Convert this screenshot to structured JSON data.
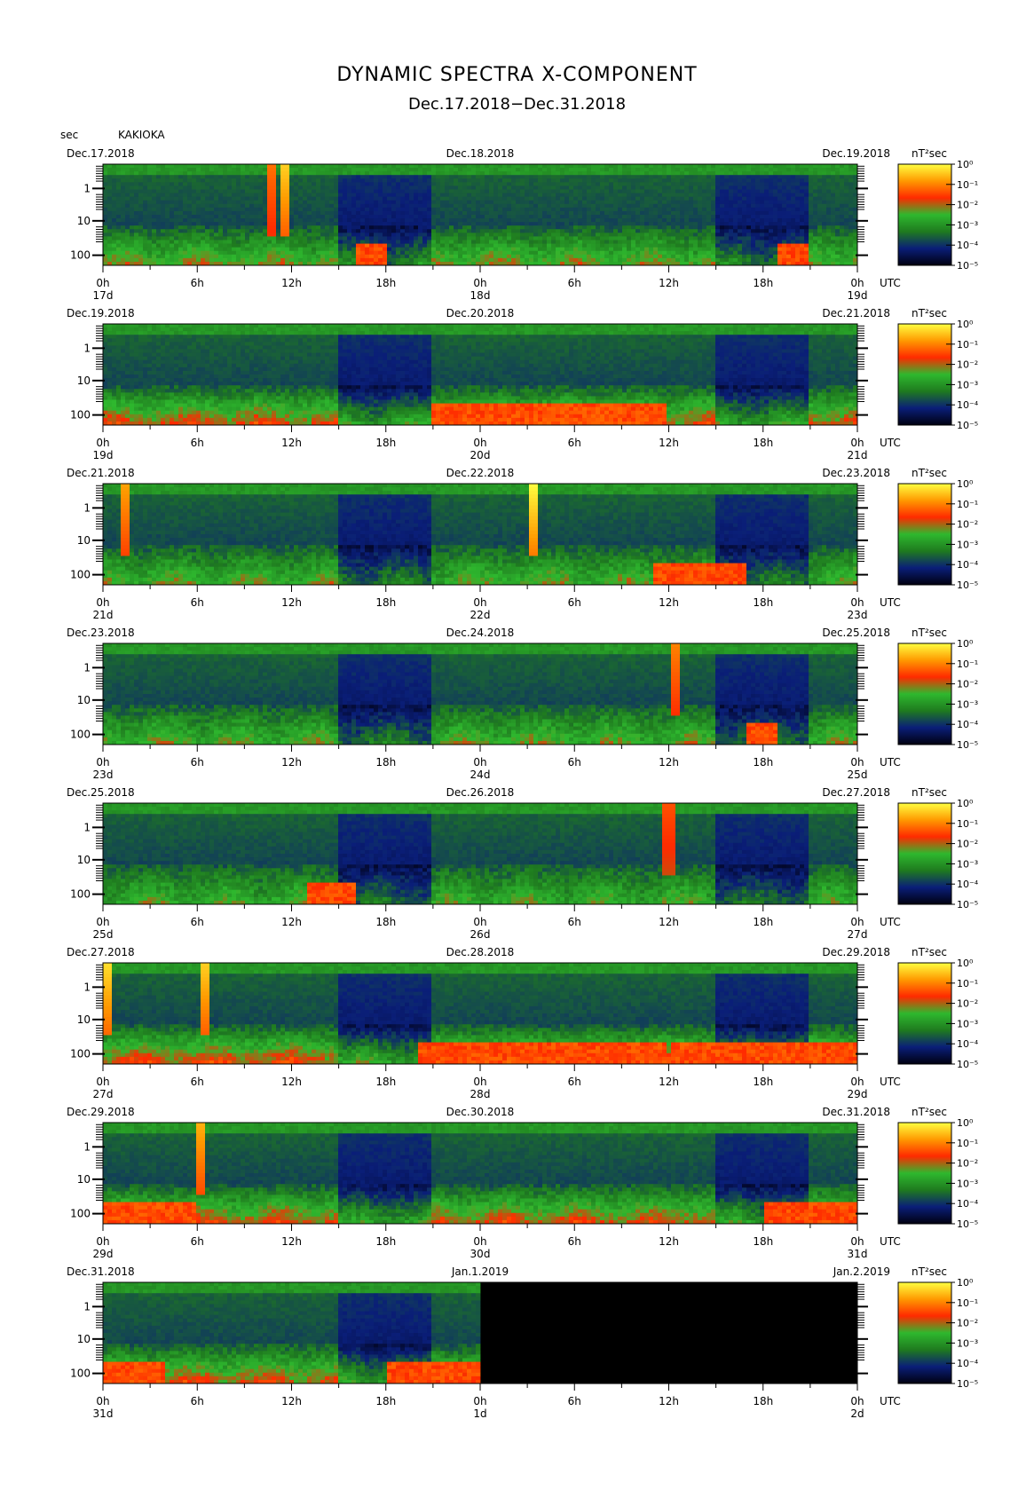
{
  "header": {
    "title": "DYNAMIC SPECTRA X-COMPONENT",
    "subtitle": "Dec.17.2018−Dec.31.2018",
    "y_unit": "sec",
    "station": "KAKIOKA"
  },
  "chart_data": {
    "type": "heatmap",
    "y_scale": "log",
    "y_axis_ticks": [
      "1",
      "10",
      "100"
    ],
    "x_hour_ticks": [
      "0h",
      "6h",
      "12h",
      "18h",
      "0h",
      "6h",
      "12h",
      "18h",
      "0h"
    ],
    "utc_label": "UTC",
    "colorbar_unit": "nT²sec",
    "colorbar_ticks": [
      "10⁰",
      "10⁻¹",
      "10⁻²",
      "10⁻³",
      "10⁻⁴",
      "10⁻⁵"
    ],
    "colormap": [
      "#000010",
      "#0a1e78",
      "#1f7a1f",
      "#2eb82e",
      "#ff2a00",
      "#ff9900",
      "#ffff40"
    ],
    "panels": [
      {
        "date_left": "Dec.17.2018",
        "date_mid": "Dec.18.2018",
        "date_right": "Dec.19.2018",
        "day_labels": [
          "17d",
          "18d",
          "19d"
        ],
        "data_fraction": 1.0,
        "low_freq_level": 0.45,
        "spikes": [
          {
            "hour": 11.5,
            "intensity": 0.85
          },
          {
            "hour": 10.8,
            "intensity": 0.55
          }
        ],
        "red_events": [
          {
            "hour": 44.0,
            "width": 1.0
          },
          {
            "hour": 17.0,
            "width": 1.0
          }
        ]
      },
      {
        "date_left": "Dec.19.2018",
        "date_mid": "Dec.20.2018",
        "date_right": "Dec.21.2018",
        "day_labels": [
          "19d",
          "20d",
          "21d"
        ],
        "data_fraction": 1.0,
        "low_freq_level": 0.6,
        "spikes": [],
        "red_events": [
          {
            "hour": 27.0,
            "width": 6.0
          },
          {
            "hour": 32.0,
            "width": 4.0
          }
        ]
      },
      {
        "date_left": "Dec.21.2018",
        "date_mid": "Dec.22.2018",
        "date_right": "Dec.23.2018",
        "day_labels": [
          "21d",
          "22d",
          "23d"
        ],
        "data_fraction": 1.0,
        "low_freq_level": 0.4,
        "spikes": [
          {
            "hour": 1.5,
            "intensity": 0.7
          },
          {
            "hour": 27.3,
            "intensity": 1.0
          }
        ],
        "red_events": [
          {
            "hour": 38.0,
            "width": 3.0
          }
        ]
      },
      {
        "date_left": "Dec.23.2018",
        "date_mid": "Dec.24.2018",
        "date_right": "Dec.25.2018",
        "day_labels": [
          "23d",
          "24d",
          "25d"
        ],
        "data_fraction": 1.0,
        "low_freq_level": 0.4,
        "spikes": [
          {
            "hour": 36.5,
            "intensity": 0.6
          }
        ],
        "red_events": [
          {
            "hour": 42.0,
            "width": 1.0
          }
        ]
      },
      {
        "date_left": "Dec.25.2018",
        "date_mid": "Dec.26.2018",
        "date_right": "Dec.27.2018",
        "day_labels": [
          "25d",
          "26d",
          "27d"
        ],
        "data_fraction": 1.0,
        "low_freq_level": 0.35,
        "spikes": [
          {
            "hour": 36.0,
            "intensity": 0.45
          }
        ],
        "red_events": [
          {
            "hour": 14.5,
            "width": 1.5
          }
        ]
      },
      {
        "date_left": "Dec.27.2018",
        "date_mid": "Dec.28.2018",
        "date_right": "Dec.29.2018",
        "day_labels": [
          "27d",
          "28d",
          "29d"
        ],
        "data_fraction": 1.0,
        "low_freq_level": 0.65,
        "spikes": [
          {
            "hour": 0.3,
            "intensity": 0.9
          },
          {
            "hour": 6.5,
            "intensity": 0.85
          }
        ],
        "red_events": [
          {
            "hour": 28.0,
            "width": 8.0
          },
          {
            "hour": 42.0,
            "width": 6.0
          }
        ]
      },
      {
        "date_left": "Dec.29.2018",
        "date_mid": "Dec.30.2018",
        "date_right": "Dec.31.2018",
        "day_labels": [
          "29d",
          "30d",
          "31d"
        ],
        "data_fraction": 1.0,
        "low_freq_level": 0.6,
        "spikes": [
          {
            "hour": 6.3,
            "intensity": 0.75
          }
        ],
        "red_events": [
          {
            "hour": 2.0,
            "width": 4.0
          },
          {
            "hour": 45.0,
            "width": 3.0
          }
        ]
      },
      {
        "date_left": "Dec.31.2018",
        "date_mid": "Jan.1.2019",
        "date_right": "Jan.2.2019",
        "day_labels": [
          "31d",
          "1d",
          "2d"
        ],
        "data_fraction": 0.5,
        "low_freq_level": 0.6,
        "spikes": [],
        "red_events": [
          {
            "hour": 21.0,
            "width": 3.0
          },
          {
            "hour": 2.0,
            "width": 2.0
          }
        ]
      }
    ]
  }
}
